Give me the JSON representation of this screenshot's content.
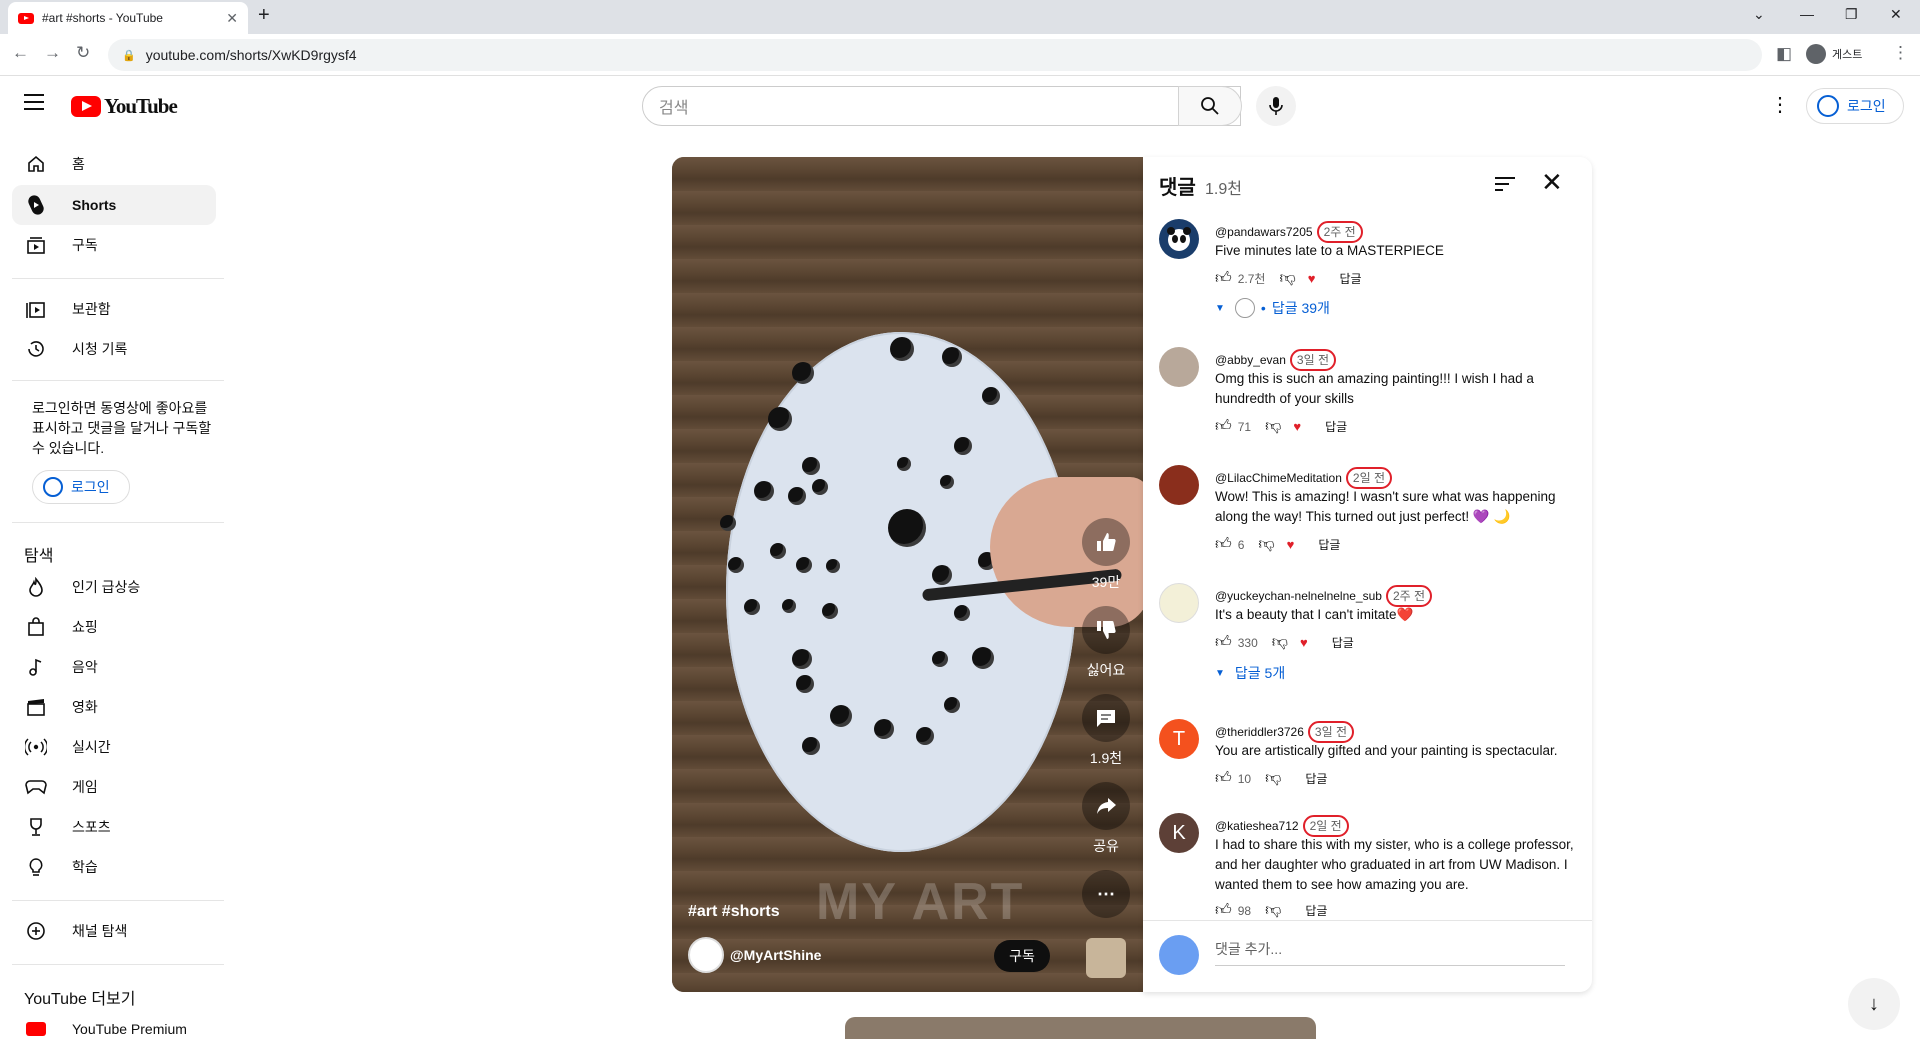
{
  "browser": {
    "tab_title": "#art #shorts - YouTube",
    "url": "youtube.com/shorts/XwKD9rgysf4",
    "profile_label": "게스트"
  },
  "masthead": {
    "search_placeholder": "검색",
    "login_label": "로그인"
  },
  "sidebar": {
    "primary": [
      {
        "label": "홈",
        "icon": "home-icon"
      },
      {
        "label": "Shorts",
        "icon": "shorts-icon",
        "active": true
      },
      {
        "label": "구독",
        "icon": "subscriptions-icon"
      }
    ],
    "library": [
      {
        "label": "보관함",
        "icon": "library-icon"
      },
      {
        "label": "시청 기록",
        "icon": "history-icon"
      }
    ],
    "login_note": "로그인하면 동영상에 좋아요를 표시하고 댓글을 달거나 구독할 수 있습니다.",
    "login_label": "로그인",
    "explore_title": "탐색",
    "explore": [
      {
        "label": "인기 급상승",
        "icon": "trending-icon"
      },
      {
        "label": "쇼핑",
        "icon": "shopping-icon"
      },
      {
        "label": "음악",
        "icon": "music-icon"
      },
      {
        "label": "영화",
        "icon": "movie-icon"
      },
      {
        "label": "실시간",
        "icon": "live-icon"
      },
      {
        "label": "게임",
        "icon": "gaming-icon"
      },
      {
        "label": "스포츠",
        "icon": "sports-icon"
      },
      {
        "label": "학습",
        "icon": "learning-icon"
      }
    ],
    "browse_channels": "채널 탐색",
    "more_title": "YouTube 더보기",
    "premium": "YouTube Premium"
  },
  "player": {
    "tags": "#art #shorts",
    "channel": "@MyArtShine",
    "subscribe_label": "구독",
    "watermark": "MY ART",
    "like_count": "39만",
    "dislike_label": "싫어요",
    "comment_count": "1.9천",
    "share_label": "공유"
  },
  "comments": {
    "title": "댓글",
    "count": "1.9천",
    "reply_label": "답글",
    "add_placeholder": "댓글 추가...",
    "items": [
      {
        "author": "@pandawars7205",
        "time": "2주 전",
        "text": "Five minutes late to a MASTERPIECE",
        "likes": "2.7천",
        "replies": "답글 39개",
        "avatar_color": "#1a3d6b"
      },
      {
        "author": "@abby_evan",
        "time": "3일 전",
        "text": "Omg this is such an amazing painting!!! I wish I had a hundredth of your skills",
        "likes": "71",
        "replies": "",
        "avatar_color": "#b8a89a"
      },
      {
        "author": "@LilacChimeMeditation",
        "time": "2일 전",
        "text": "Wow! This is amazing! I wasn't sure what was happening along the way! This turned out just perfect! 💜 🌙",
        "likes": "6",
        "replies": "",
        "avatar_color": "#8a2e1c"
      },
      {
        "author": "@yuckeychan-nelnelnelne_sub",
        "time": "2주 전",
        "text": "It's a beauty that I can't imitate❤️",
        "likes": "330",
        "replies": "답글 5개",
        "avatar_color": "#f3f0d8"
      },
      {
        "author": "@theriddler3726",
        "time": "3일 전",
        "text": "You are artistically gifted and your painting is spectacular.",
        "likes": "10",
        "replies": "",
        "avatar_color": "#f4511e",
        "initial": "T"
      },
      {
        "author": "@katieshea712",
        "time": "2일 전",
        "text": "I had to share this with my sister, who is a college professor, and her daughter who graduated in art from UW Madison. I wanted them to see how amazing you are.",
        "likes": "98",
        "replies": "",
        "avatar_color": "#5d4037",
        "initial": "K"
      }
    ]
  }
}
